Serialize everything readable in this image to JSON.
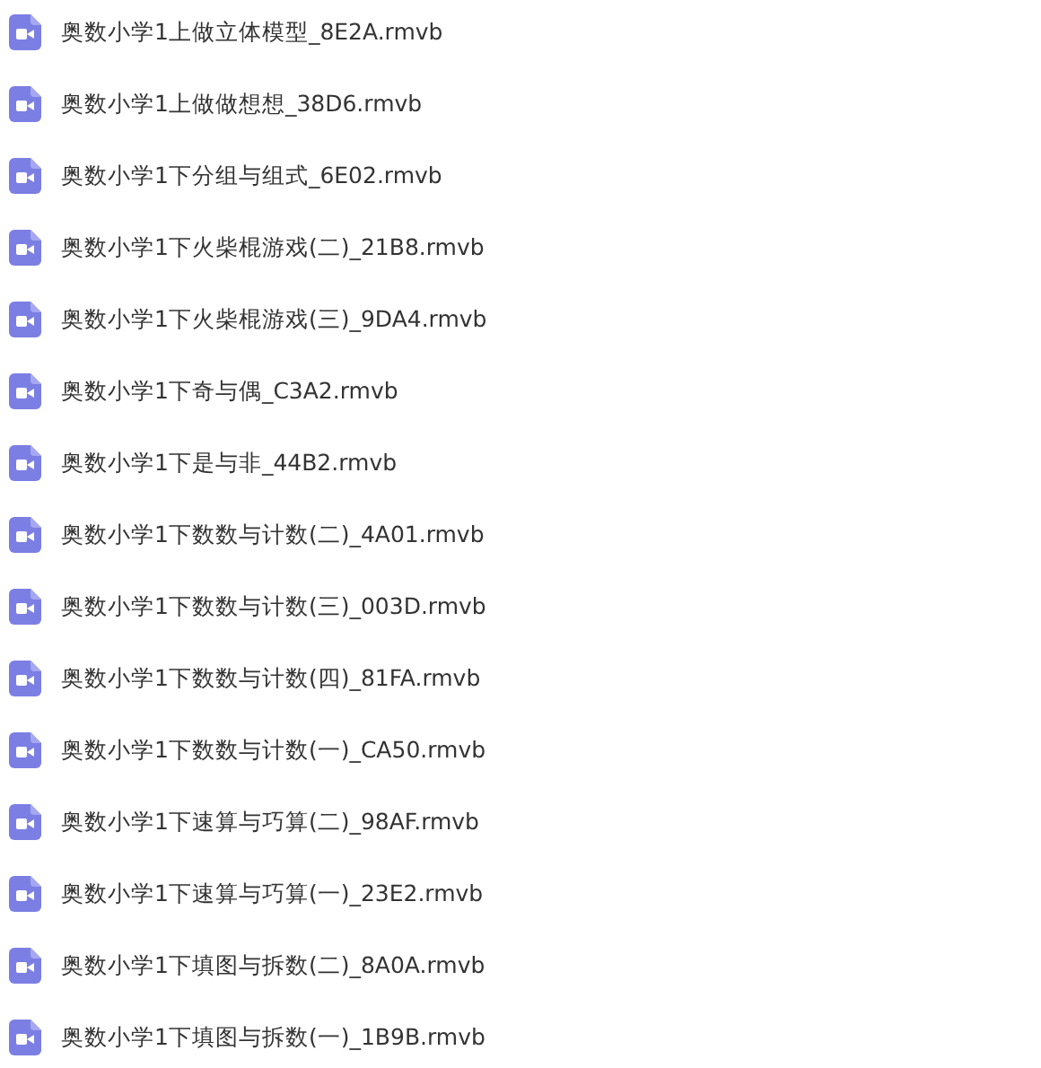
{
  "files": [
    {
      "name": "奥数小学1上做立体模型_8E2A.rmvb"
    },
    {
      "name": "奥数小学1上做做想想_38D6.rmvb"
    },
    {
      "name": "奥数小学1下分组与组式_6E02.rmvb"
    },
    {
      "name": "奥数小学1下火柴棍游戏(二)_21B8.rmvb"
    },
    {
      "name": "奥数小学1下火柴棍游戏(三)_9DA4.rmvb"
    },
    {
      "name": "奥数小学1下奇与偶_C3A2.rmvb"
    },
    {
      "name": "奥数小学1下是与非_44B2.rmvb"
    },
    {
      "name": "奥数小学1下数数与计数(二)_4A01.rmvb"
    },
    {
      "name": "奥数小学1下数数与计数(三)_003D.rmvb"
    },
    {
      "name": "奥数小学1下数数与计数(四)_81FA.rmvb"
    },
    {
      "name": "奥数小学1下数数与计数(一)_CA50.rmvb"
    },
    {
      "name": "奥数小学1下速算与巧算(二)_98AF.rmvb"
    },
    {
      "name": "奥数小学1下速算与巧算(一)_23E2.rmvb"
    },
    {
      "name": "奥数小学1下填图与拆数(二)_8A0A.rmvb"
    },
    {
      "name": "奥数小学1下填图与拆数(一)_1B9B.rmvb"
    }
  ]
}
